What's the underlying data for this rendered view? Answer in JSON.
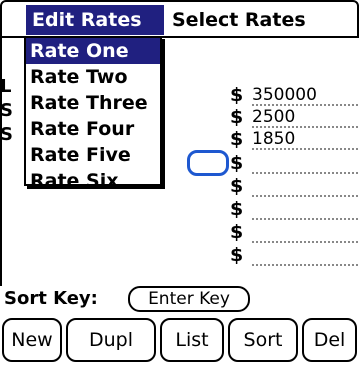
{
  "menubar": {
    "menus": [
      {
        "label": "Edit Rates",
        "active": true
      },
      {
        "label": "Select Rates",
        "active": false
      }
    ]
  },
  "dropdown": {
    "items": [
      {
        "label": "Rate One",
        "selected": true
      },
      {
        "label": "Rate Two",
        "selected": false
      },
      {
        "label": "Rate Three",
        "selected": false
      },
      {
        "label": "Rate Four",
        "selected": false
      },
      {
        "label": "Rate Five",
        "selected": false
      },
      {
        "label": "Rate Six",
        "selected": false
      }
    ]
  },
  "form": {
    "partial_labels": [
      "L",
      "S",
      "S"
    ],
    "rates": [
      {
        "symbol": "$",
        "value": "350000"
      },
      {
        "symbol": "$",
        "value": "2500"
      },
      {
        "symbol": "$",
        "value": "1850"
      },
      {
        "symbol": "$",
        "value": ""
      },
      {
        "symbol": "$",
        "value": ""
      },
      {
        "symbol": "$",
        "value": ""
      },
      {
        "symbol": "$",
        "value": ""
      },
      {
        "symbol": "$",
        "value": ""
      }
    ]
  },
  "sort": {
    "label": "Sort Key:",
    "input_placeholder": "Enter Key"
  },
  "buttons": [
    {
      "label": "New"
    },
    {
      "label": "Dupl"
    },
    {
      "label": "List"
    },
    {
      "label": "Sort"
    },
    {
      "label": "Del"
    }
  ],
  "colors": {
    "highlight": "#202080",
    "focus": "#1e58d0"
  }
}
